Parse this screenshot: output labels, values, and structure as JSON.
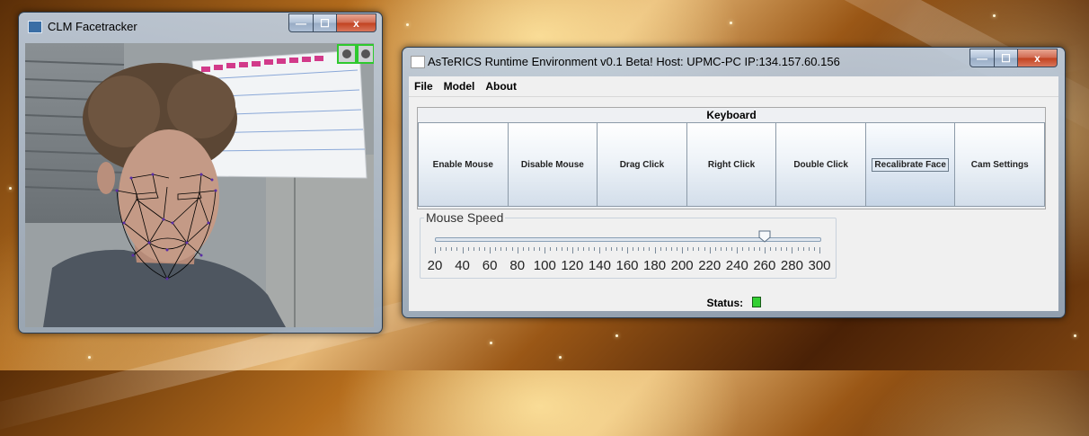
{
  "cam_window": {
    "title": "CLM Facetracker",
    "buttons": {
      "minimize": "—",
      "maximize": "☐",
      "close": "x"
    },
    "calendar_icons": [
      "eye-icon",
      "hand-icon"
    ]
  },
  "asterics_window": {
    "title": "AsTeRICS Runtime Environment  v0.1 Beta! Host: UPMC-PC  IP:134.157.60.156",
    "buttons": {
      "minimize": "—",
      "maximize": "☐",
      "close": "x"
    },
    "menu": [
      "File",
      "Model",
      "About"
    ],
    "keyboard": {
      "title": "Keyboard",
      "buttons": [
        "Enable Mouse",
        "Disable Mouse",
        "Drag Click",
        "Right Click",
        "Double Click",
        "Recalibrate Face",
        "Cam Settings"
      ],
      "focused_index": 5
    },
    "mouse_speed": {
      "label": "Mouse Speed",
      "min": 20,
      "max": 300,
      "value": 260,
      "tick_labels": [
        "20",
        "40",
        "60",
        "80",
        "100",
        "120",
        "140",
        "160",
        "180",
        "200",
        "220",
        "240",
        "260",
        "280",
        "300"
      ]
    },
    "status": {
      "label": "Status:",
      "color": "#33d033"
    }
  },
  "colors": {
    "accent_green": "#33d033",
    "face_mesh_black": "#000000",
    "face_mesh_points": "#5a2ea6",
    "eye_box_green": "#2ec92e"
  }
}
